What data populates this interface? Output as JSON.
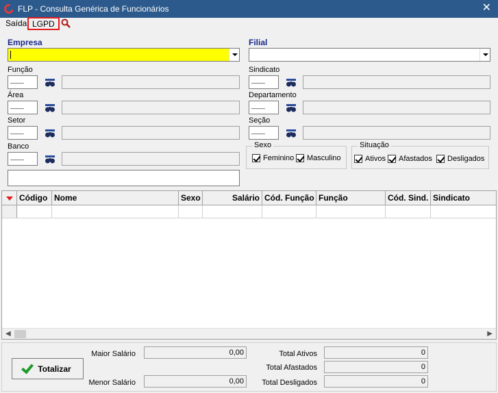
{
  "window": {
    "title": "FLP - Consulta Genérica de Funcionários",
    "close_glyph": "✕"
  },
  "menu": {
    "saida": "Saída",
    "lgpd": "LGPD"
  },
  "filters": {
    "empresa_label": "Empresa",
    "filial_label": "Filial",
    "funcao_label": "Função",
    "sindicato_label": "Sindicato",
    "area_label": "Área",
    "departamento_label": "Departamento",
    "setor_label": "Setor",
    "secao_label": "Seção",
    "banco_label": "Banco",
    "code_placeholder": "___"
  },
  "sexo": {
    "title": "Sexo",
    "feminino": "Feminino",
    "masculino": "Masculino"
  },
  "situacao": {
    "title": "Situação",
    "ativos": "Ativos",
    "afastados": "Afastados",
    "desligados": "Desligados"
  },
  "grid": {
    "columns": [
      "Código",
      "Nome",
      "Sexo",
      "Salário",
      "Cód. Função",
      "Função",
      "Cód. Sind.",
      "Sindicato"
    ]
  },
  "footer": {
    "totalizar": "Totalizar",
    "maior_salario_label": "Maior Salário",
    "maior_salario_value": "0,00",
    "menor_salario_label": "Menor Salário",
    "menor_salario_value": "0,00",
    "total_ativos_label": "Total Ativos",
    "total_ativos_value": "0",
    "total_afastados_label": "Total Afastados",
    "total_afastados_value": "0",
    "total_desligados_label": "Total Desligados",
    "total_desligados_value": "0"
  },
  "colors": {
    "titlebar": "#2c5a8c",
    "empresa_field": "#ffff00",
    "highlight": "#e31b1b",
    "check": "#1e9a2a"
  }
}
